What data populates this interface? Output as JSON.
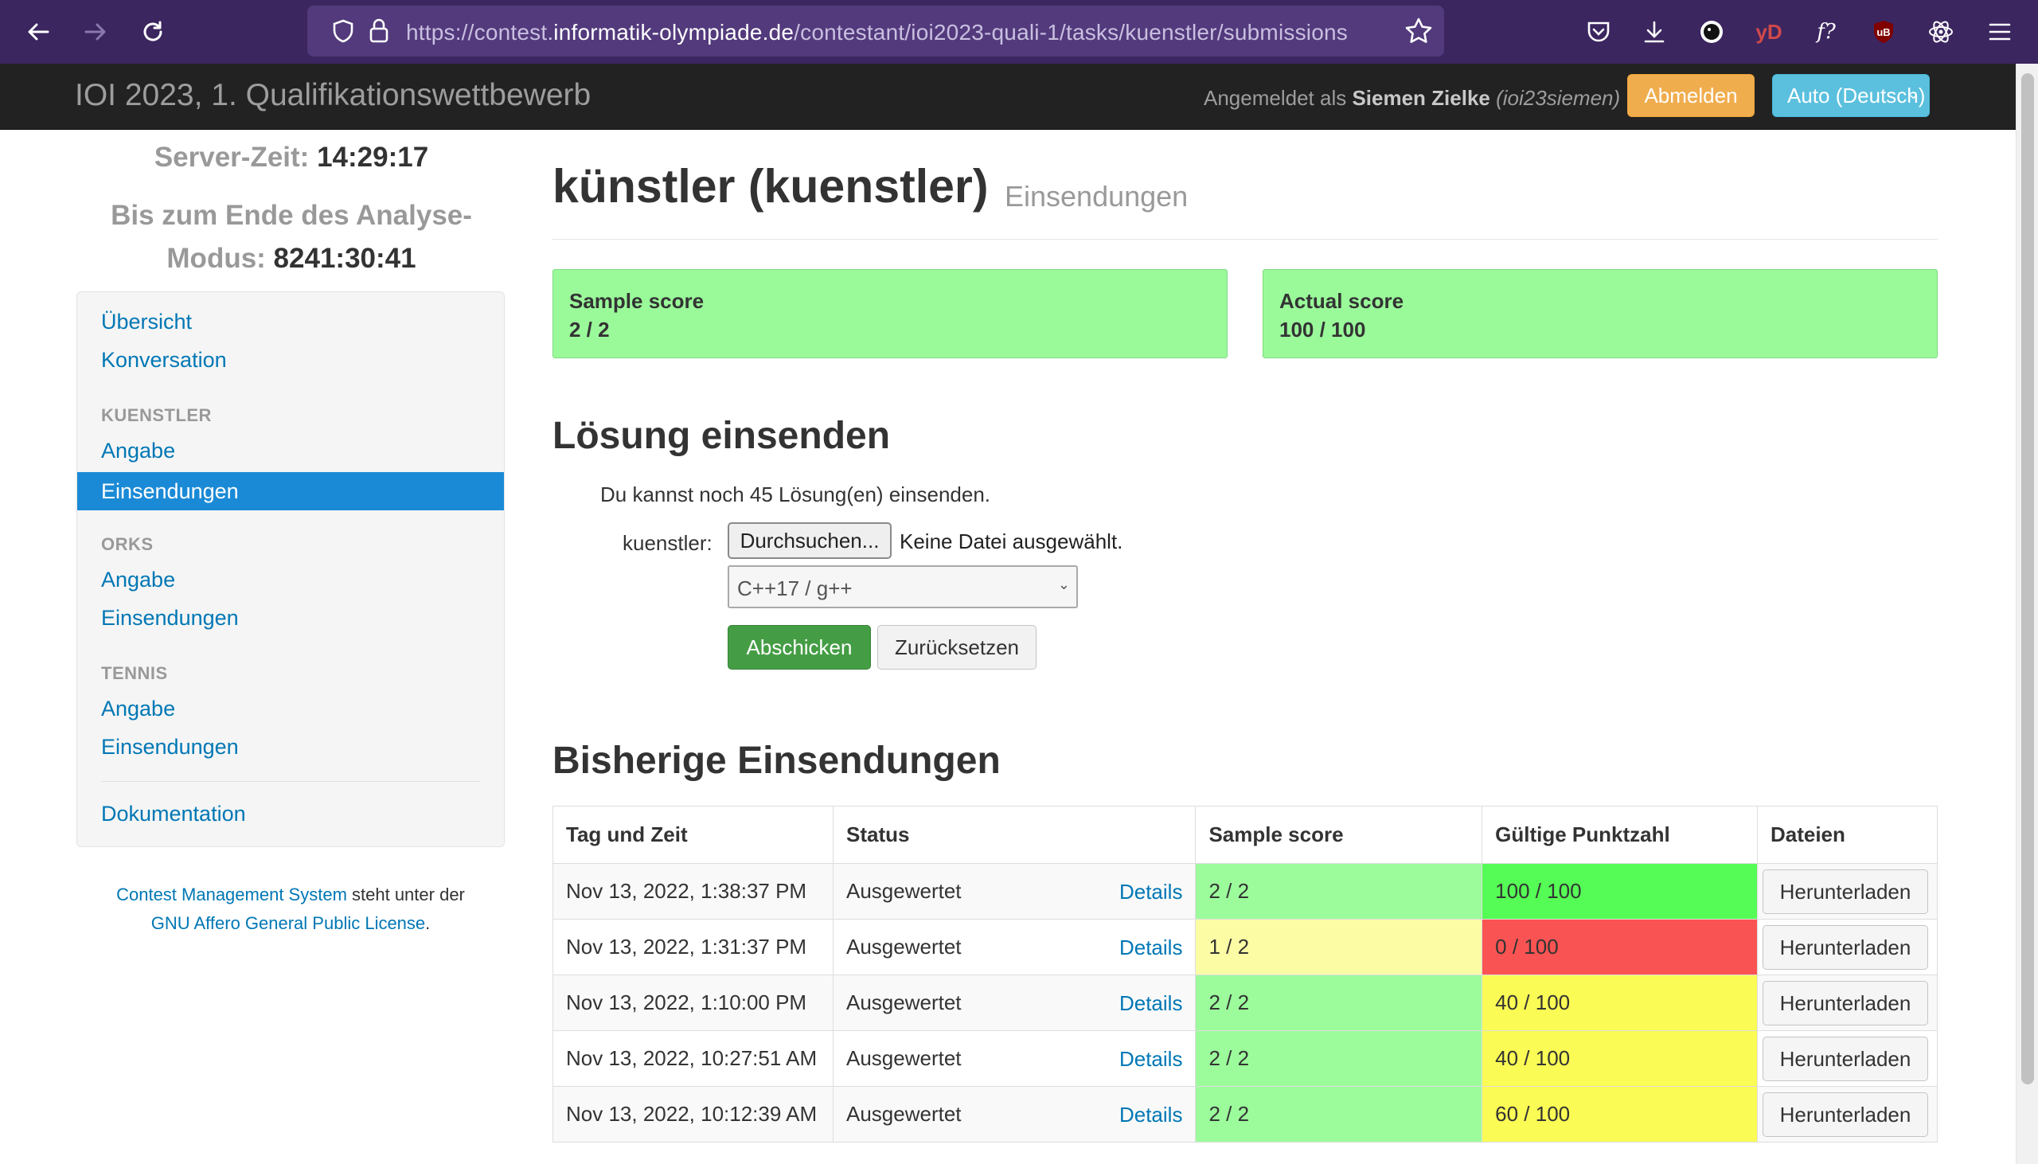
{
  "browser": {
    "url_prefix": "https://contest.",
    "url_domain": "informatik-olympiade.de",
    "url_path": "/contestant/ioi2023-quali-1/tasks/kuenstler/submissions",
    "ext_yd": "yD",
    "ext_fq": "f?",
    "ext_ub": "uB"
  },
  "navbar": {
    "brand": "IOI 2023, 1. Qualifikationswettbewerb",
    "login_prefix": "Angemeldet als ",
    "user_name": "Siemen Zielke",
    "user_id": "(ioi23siemen)",
    "logout_label": "Abmelden",
    "language_label": "Auto (Deutsch)"
  },
  "sidebar": {
    "server_time_label": "Server-Zeit: ",
    "server_time_value": "14:29:17",
    "remaining_label": "Bis zum Ende des Analyse-Modus: ",
    "remaining_value": "8241:30:41",
    "overview": "Übersicht",
    "communication": "Konversation",
    "tasks": [
      {
        "header": "KUENSTLER",
        "statement": "Angabe",
        "submissions": "Einsendungen"
      },
      {
        "header": "ORKS",
        "statement": "Angabe",
        "submissions": "Einsendungen"
      },
      {
        "header": "TENNIS",
        "statement": "Angabe",
        "submissions": "Einsendungen"
      }
    ],
    "documentation": "Dokumentation",
    "footer_link1": "Contest Management System",
    "footer_text": " steht unter der",
    "footer_link2": "GNU Affero General Public License",
    "footer_end": "."
  },
  "main": {
    "title": "künstler (kuenstler)",
    "subtitle": "Einsendungen",
    "sample_score_title": "Sample score",
    "sample_score_value": "2 / 2",
    "actual_score_title": "Actual score",
    "actual_score_value": "100 / 100",
    "submit_heading": "Lösung einsenden",
    "remaining_submissions": "Du kannst noch 45 Lösung(en) einsenden.",
    "file_label": "kuenstler:",
    "browse_label": "Durchsuchen...",
    "no_file": "Keine Datei ausgewählt.",
    "language_value": "C++17 / g++",
    "send_label": "Abschicken",
    "reset_label": "Zurücksetzen",
    "prev_heading": "Bisherige Einsendungen"
  },
  "table": {
    "headers": [
      "Tag und Zeit",
      "Status",
      "Sample score",
      "Gültige Punktzahl",
      "Dateien"
    ],
    "rows": [
      {
        "time": "Nov 13, 2022, 1:38:37 PM",
        "status": "Ausgewertet",
        "details": "Details",
        "sample": "2 / 2",
        "score": "100 / 100",
        "download": "Herunterladen"
      },
      {
        "time": "Nov 13, 2022, 1:31:37 PM",
        "status": "Ausgewertet",
        "details": "Details",
        "sample": "1 / 2",
        "score": "0 / 100",
        "download": "Herunterladen"
      },
      {
        "time": "Nov 13, 2022, 1:10:00 PM",
        "status": "Ausgewertet",
        "details": "Details",
        "sample": "2 / 2",
        "score": "40 / 100",
        "download": "Herunterladen"
      },
      {
        "time": "Nov 13, 2022, 10:27:51 AM",
        "status": "Ausgewertet",
        "details": "Details",
        "sample": "2 / 2",
        "score": "40 / 100",
        "download": "Herunterladen"
      },
      {
        "time": "Nov 13, 2022, 10:12:39 AM",
        "status": "Ausgewertet",
        "details": "Details",
        "sample": "2 / 2",
        "score": "60 / 100",
        "download": "Herunterladen"
      }
    ]
  },
  "colors": {
    "score_full": "#55fc55",
    "score_zero": "#f95453",
    "score_partial": "#fbfb55",
    "sample_full": "#9cfc9c",
    "sample_partial": "#fcfca5",
    "active_nav": "#1a8ad6"
  }
}
